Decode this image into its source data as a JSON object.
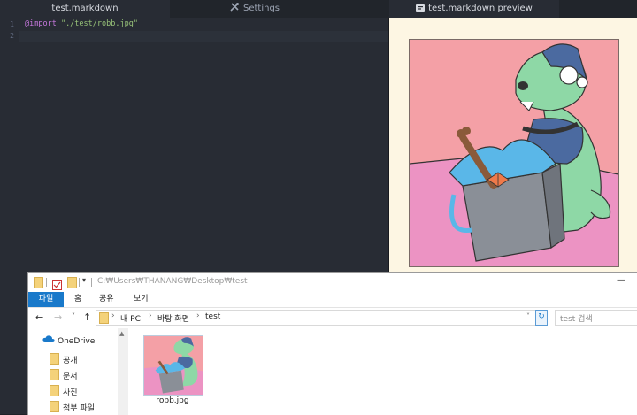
{
  "tabs": [
    {
      "label": "test.markdown",
      "active": true
    },
    {
      "label": "Settings",
      "icon": "tools-icon"
    },
    {
      "label": "test.markdown preview",
      "icon": "preview-icon",
      "active": true
    }
  ],
  "editor": {
    "line_numbers": [
      "1",
      "2"
    ],
    "code_keyword": "@import",
    "code_string": "\"./test/robb.jpg\""
  },
  "explorer": {
    "path_title": "C:₩Users₩THANANG₩Desktop₩test",
    "ribbon_tabs": [
      "파일",
      "홈",
      "공유",
      "보기"
    ],
    "breadcrumbs": [
      "내 PC",
      "바탕 화면",
      "test"
    ],
    "search_placeholder": "test 검색",
    "nav_items": [
      "OneDrive",
      "공개",
      "문서",
      "사진",
      "첨부 파일"
    ],
    "file_name": "robb.jpg"
  },
  "colors": {
    "editor_bg": "#282c34",
    "preview_bg": "#fdf6e3",
    "ribbon_file": "#1979ca",
    "image_pink_bg": "#f4a0a6"
  }
}
